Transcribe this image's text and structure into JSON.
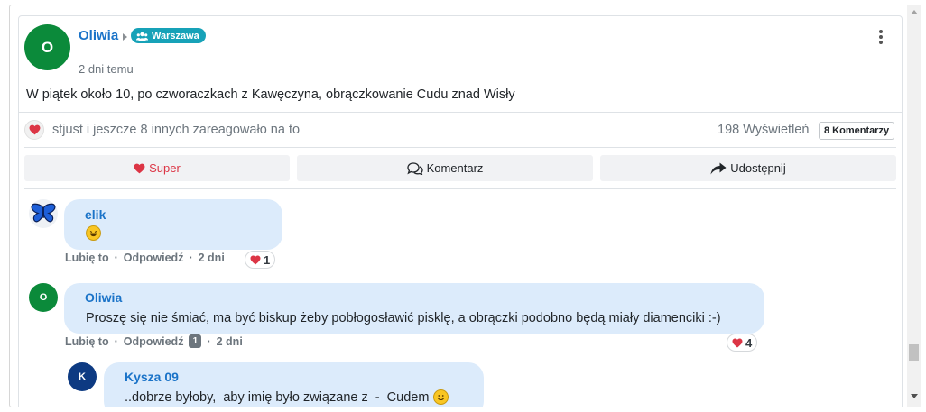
{
  "post": {
    "author": "Oliwia",
    "avatar_initial": "O",
    "group": "Warszawa",
    "time": "2 dni temu",
    "text": "W piątek około 10, po czworaczkach z Kawęczyna, obrączkowanie Cudu znad Wisły",
    "reactions_text": "stjust i jeszcze 8 innych zareagowało na to",
    "views": "198 Wyświetleń",
    "comments_badge": "8 Komentarzy",
    "colors": {
      "accent": "#1a73c8",
      "group_badge": "#17a2b8",
      "heart": "#dc3545",
      "avatar_green": "#0b8a3a",
      "avatar_navy": "#0d3a82",
      "bubble": "#dcebfb"
    }
  },
  "actions": {
    "super": "Super",
    "comment": "Komentarz",
    "share": "Udostępnij"
  },
  "comments": [
    {
      "author": "elik",
      "avatar_icon": "butterfly-icon",
      "text_icon": "laughing-emoji-icon",
      "like_label": "Lubię to",
      "reply_label": "Odpowiedź",
      "time": "2 dni",
      "likes": "1"
    },
    {
      "author": "Oliwia",
      "avatar_initial": "O",
      "text": "Proszę się nie śmiać, ma być biskup żeby pobłogosławić pisklę, a obrączki podobno będą miały diamenciki :-)",
      "like_label": "Lubię to",
      "reply_label": "Odpowiedź",
      "reply_count": "1",
      "time": "2 dni",
      "likes": "4"
    },
    {
      "author": "Kysza 09",
      "avatar_initial": "K",
      "text": "..dobrze byłoby,  aby imię było związane z  -  Cudem",
      "text_icon": "smiley-emoji-icon"
    }
  ]
}
